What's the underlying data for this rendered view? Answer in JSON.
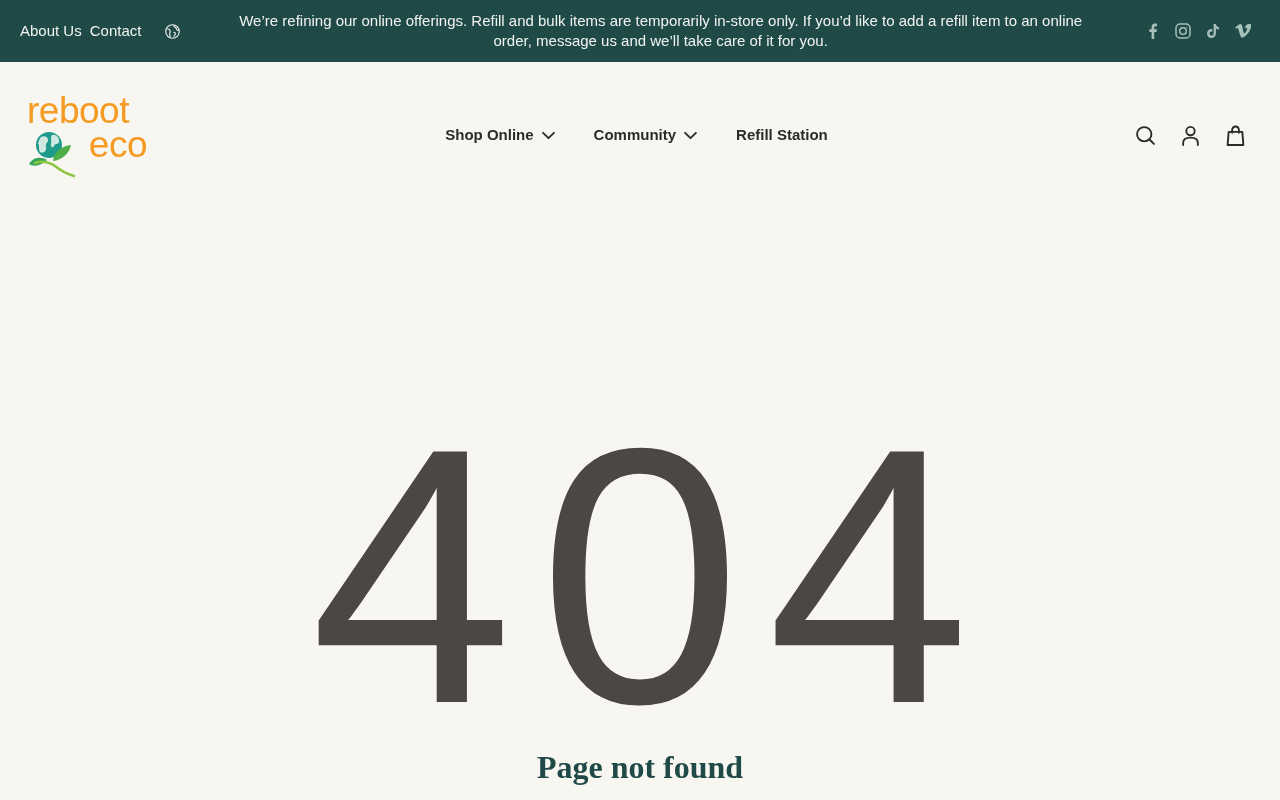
{
  "announcement_bar": {
    "links": [
      "About Us",
      "Contact"
    ],
    "message": "We’re refining our online offerings. Refill and bulk items are temporarily in-store only. If you’d like to add a refill item to an online order, message us and we’ll take care of it for you."
  },
  "header": {
    "logo": {
      "line_1": "reboot",
      "line_2": "eco"
    },
    "nav": [
      {
        "label": "Shop Online",
        "has_menu": true
      },
      {
        "label": "Community",
        "has_menu": true
      },
      {
        "label": "Refill Station",
        "has_menu": false
      }
    ]
  },
  "error": {
    "code": "404",
    "heading": "Page not found"
  }
}
